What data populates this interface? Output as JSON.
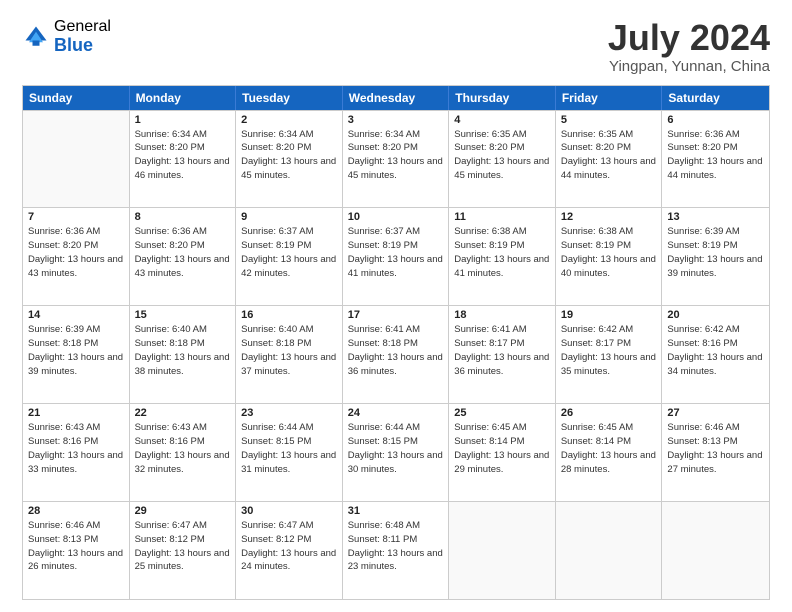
{
  "header": {
    "logo_general": "General",
    "logo_blue": "Blue",
    "month_year": "July 2024",
    "location": "Yingpan, Yunnan, China"
  },
  "weekdays": [
    "Sunday",
    "Monday",
    "Tuesday",
    "Wednesday",
    "Thursday",
    "Friday",
    "Saturday"
  ],
  "rows": [
    [
      {
        "day": "",
        "sunrise": "",
        "sunset": "",
        "daylight": ""
      },
      {
        "day": "1",
        "sunrise": "Sunrise: 6:34 AM",
        "sunset": "Sunset: 8:20 PM",
        "daylight": "Daylight: 13 hours and 46 minutes."
      },
      {
        "day": "2",
        "sunrise": "Sunrise: 6:34 AM",
        "sunset": "Sunset: 8:20 PM",
        "daylight": "Daylight: 13 hours and 45 minutes."
      },
      {
        "day": "3",
        "sunrise": "Sunrise: 6:34 AM",
        "sunset": "Sunset: 8:20 PM",
        "daylight": "Daylight: 13 hours and 45 minutes."
      },
      {
        "day": "4",
        "sunrise": "Sunrise: 6:35 AM",
        "sunset": "Sunset: 8:20 PM",
        "daylight": "Daylight: 13 hours and 45 minutes."
      },
      {
        "day": "5",
        "sunrise": "Sunrise: 6:35 AM",
        "sunset": "Sunset: 8:20 PM",
        "daylight": "Daylight: 13 hours and 44 minutes."
      },
      {
        "day": "6",
        "sunrise": "Sunrise: 6:36 AM",
        "sunset": "Sunset: 8:20 PM",
        "daylight": "Daylight: 13 hours and 44 minutes."
      }
    ],
    [
      {
        "day": "7",
        "sunrise": "Sunrise: 6:36 AM",
        "sunset": "Sunset: 8:20 PM",
        "daylight": "Daylight: 13 hours and 43 minutes."
      },
      {
        "day": "8",
        "sunrise": "Sunrise: 6:36 AM",
        "sunset": "Sunset: 8:20 PM",
        "daylight": "Daylight: 13 hours and 43 minutes."
      },
      {
        "day": "9",
        "sunrise": "Sunrise: 6:37 AM",
        "sunset": "Sunset: 8:19 PM",
        "daylight": "Daylight: 13 hours and 42 minutes."
      },
      {
        "day": "10",
        "sunrise": "Sunrise: 6:37 AM",
        "sunset": "Sunset: 8:19 PM",
        "daylight": "Daylight: 13 hours and 41 minutes."
      },
      {
        "day": "11",
        "sunrise": "Sunrise: 6:38 AM",
        "sunset": "Sunset: 8:19 PM",
        "daylight": "Daylight: 13 hours and 41 minutes."
      },
      {
        "day": "12",
        "sunrise": "Sunrise: 6:38 AM",
        "sunset": "Sunset: 8:19 PM",
        "daylight": "Daylight: 13 hours and 40 minutes."
      },
      {
        "day": "13",
        "sunrise": "Sunrise: 6:39 AM",
        "sunset": "Sunset: 8:19 PM",
        "daylight": "Daylight: 13 hours and 39 minutes."
      }
    ],
    [
      {
        "day": "14",
        "sunrise": "Sunrise: 6:39 AM",
        "sunset": "Sunset: 8:18 PM",
        "daylight": "Daylight: 13 hours and 39 minutes."
      },
      {
        "day": "15",
        "sunrise": "Sunrise: 6:40 AM",
        "sunset": "Sunset: 8:18 PM",
        "daylight": "Daylight: 13 hours and 38 minutes."
      },
      {
        "day": "16",
        "sunrise": "Sunrise: 6:40 AM",
        "sunset": "Sunset: 8:18 PM",
        "daylight": "Daylight: 13 hours and 37 minutes."
      },
      {
        "day": "17",
        "sunrise": "Sunrise: 6:41 AM",
        "sunset": "Sunset: 8:18 PM",
        "daylight": "Daylight: 13 hours and 36 minutes."
      },
      {
        "day": "18",
        "sunrise": "Sunrise: 6:41 AM",
        "sunset": "Sunset: 8:17 PM",
        "daylight": "Daylight: 13 hours and 36 minutes."
      },
      {
        "day": "19",
        "sunrise": "Sunrise: 6:42 AM",
        "sunset": "Sunset: 8:17 PM",
        "daylight": "Daylight: 13 hours and 35 minutes."
      },
      {
        "day": "20",
        "sunrise": "Sunrise: 6:42 AM",
        "sunset": "Sunset: 8:16 PM",
        "daylight": "Daylight: 13 hours and 34 minutes."
      }
    ],
    [
      {
        "day": "21",
        "sunrise": "Sunrise: 6:43 AM",
        "sunset": "Sunset: 8:16 PM",
        "daylight": "Daylight: 13 hours and 33 minutes."
      },
      {
        "day": "22",
        "sunrise": "Sunrise: 6:43 AM",
        "sunset": "Sunset: 8:16 PM",
        "daylight": "Daylight: 13 hours and 32 minutes."
      },
      {
        "day": "23",
        "sunrise": "Sunrise: 6:44 AM",
        "sunset": "Sunset: 8:15 PM",
        "daylight": "Daylight: 13 hours and 31 minutes."
      },
      {
        "day": "24",
        "sunrise": "Sunrise: 6:44 AM",
        "sunset": "Sunset: 8:15 PM",
        "daylight": "Daylight: 13 hours and 30 minutes."
      },
      {
        "day": "25",
        "sunrise": "Sunrise: 6:45 AM",
        "sunset": "Sunset: 8:14 PM",
        "daylight": "Daylight: 13 hours and 29 minutes."
      },
      {
        "day": "26",
        "sunrise": "Sunrise: 6:45 AM",
        "sunset": "Sunset: 8:14 PM",
        "daylight": "Daylight: 13 hours and 28 minutes."
      },
      {
        "day": "27",
        "sunrise": "Sunrise: 6:46 AM",
        "sunset": "Sunset: 8:13 PM",
        "daylight": "Daylight: 13 hours and 27 minutes."
      }
    ],
    [
      {
        "day": "28",
        "sunrise": "Sunrise: 6:46 AM",
        "sunset": "Sunset: 8:13 PM",
        "daylight": "Daylight: 13 hours and 26 minutes."
      },
      {
        "day": "29",
        "sunrise": "Sunrise: 6:47 AM",
        "sunset": "Sunset: 8:12 PM",
        "daylight": "Daylight: 13 hours and 25 minutes."
      },
      {
        "day": "30",
        "sunrise": "Sunrise: 6:47 AM",
        "sunset": "Sunset: 8:12 PM",
        "daylight": "Daylight: 13 hours and 24 minutes."
      },
      {
        "day": "31",
        "sunrise": "Sunrise: 6:48 AM",
        "sunset": "Sunset: 8:11 PM",
        "daylight": "Daylight: 13 hours and 23 minutes."
      },
      {
        "day": "",
        "sunrise": "",
        "sunset": "",
        "daylight": ""
      },
      {
        "day": "",
        "sunrise": "",
        "sunset": "",
        "daylight": ""
      },
      {
        "day": "",
        "sunrise": "",
        "sunset": "",
        "daylight": ""
      }
    ]
  ]
}
